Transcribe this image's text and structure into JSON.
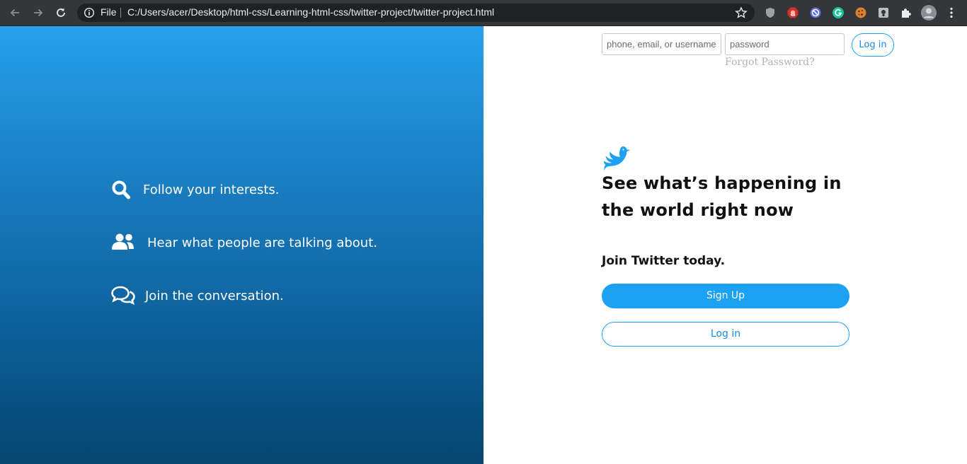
{
  "browser": {
    "file_label": "File",
    "url": "C:/Users/acer/Desktop/html-css/Learning-html-css/twitter-project/twitter-project.html",
    "icons": [
      "back-icon",
      "forward-icon",
      "reload-icon",
      "info-icon",
      "bookmark-star-icon",
      "shield-extension-icon",
      "stop-hand-extension-icon",
      "blocker-extension-icon",
      "grammarly-extension-icon",
      "cookie-extension-icon",
      "bulb-extension-icon",
      "puzzle-extensions-icon",
      "profile-avatar",
      "kebab-menu-icon"
    ]
  },
  "features": [
    {
      "icon": "search-icon",
      "text": "Follow your interests."
    },
    {
      "icon": "users-icon",
      "text": "Hear what people are talking about."
    },
    {
      "icon": "comments-icon",
      "text": "Join the conversation."
    }
  ],
  "login": {
    "username_placeholder": "phone, email, or username",
    "password_placeholder": "password",
    "button": "Log in",
    "forgot": "Forgot Password?"
  },
  "main": {
    "headline": "See what’s happening in the world right now",
    "join": "Join Twitter today.",
    "signup_button": "Sign Up",
    "login_button": "Log in"
  },
  "colors": {
    "brand_blue": "#1da1f2",
    "gradient_top": "#27a0ec",
    "gradient_bottom": "#06456f"
  }
}
